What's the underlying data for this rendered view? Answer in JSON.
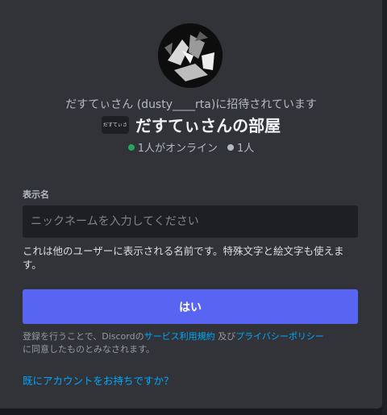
{
  "invite": {
    "inviter_line": "だすてぃさん (dusty____rta)に招待されています",
    "server_icon_text": "だすてぃさ",
    "server_name": "だすてぃさんの部屋",
    "online_count": "1人がオンライン",
    "member_count": "1人"
  },
  "form": {
    "display_name_label": "表示名",
    "nickname_placeholder": "ニックネームを入力してください",
    "hint": "これは他のユーザーに表示される名前です。特殊文字と絵文字も使えます。",
    "submit_label": "はい"
  },
  "terms": {
    "prefix": "登録を行うことで、Discordの",
    "tos_link": "サービス利用規約",
    "middle": " 及び",
    "privacy_link": "プライバシーポリシー",
    "suffix": "に同意したものとみなされます。"
  },
  "login_link": "既にアカウントをお持ちですか？",
  "colors": {
    "background": "#313338",
    "accent": "#5865f2",
    "link": "#00a8fc",
    "online": "#23a55a"
  }
}
